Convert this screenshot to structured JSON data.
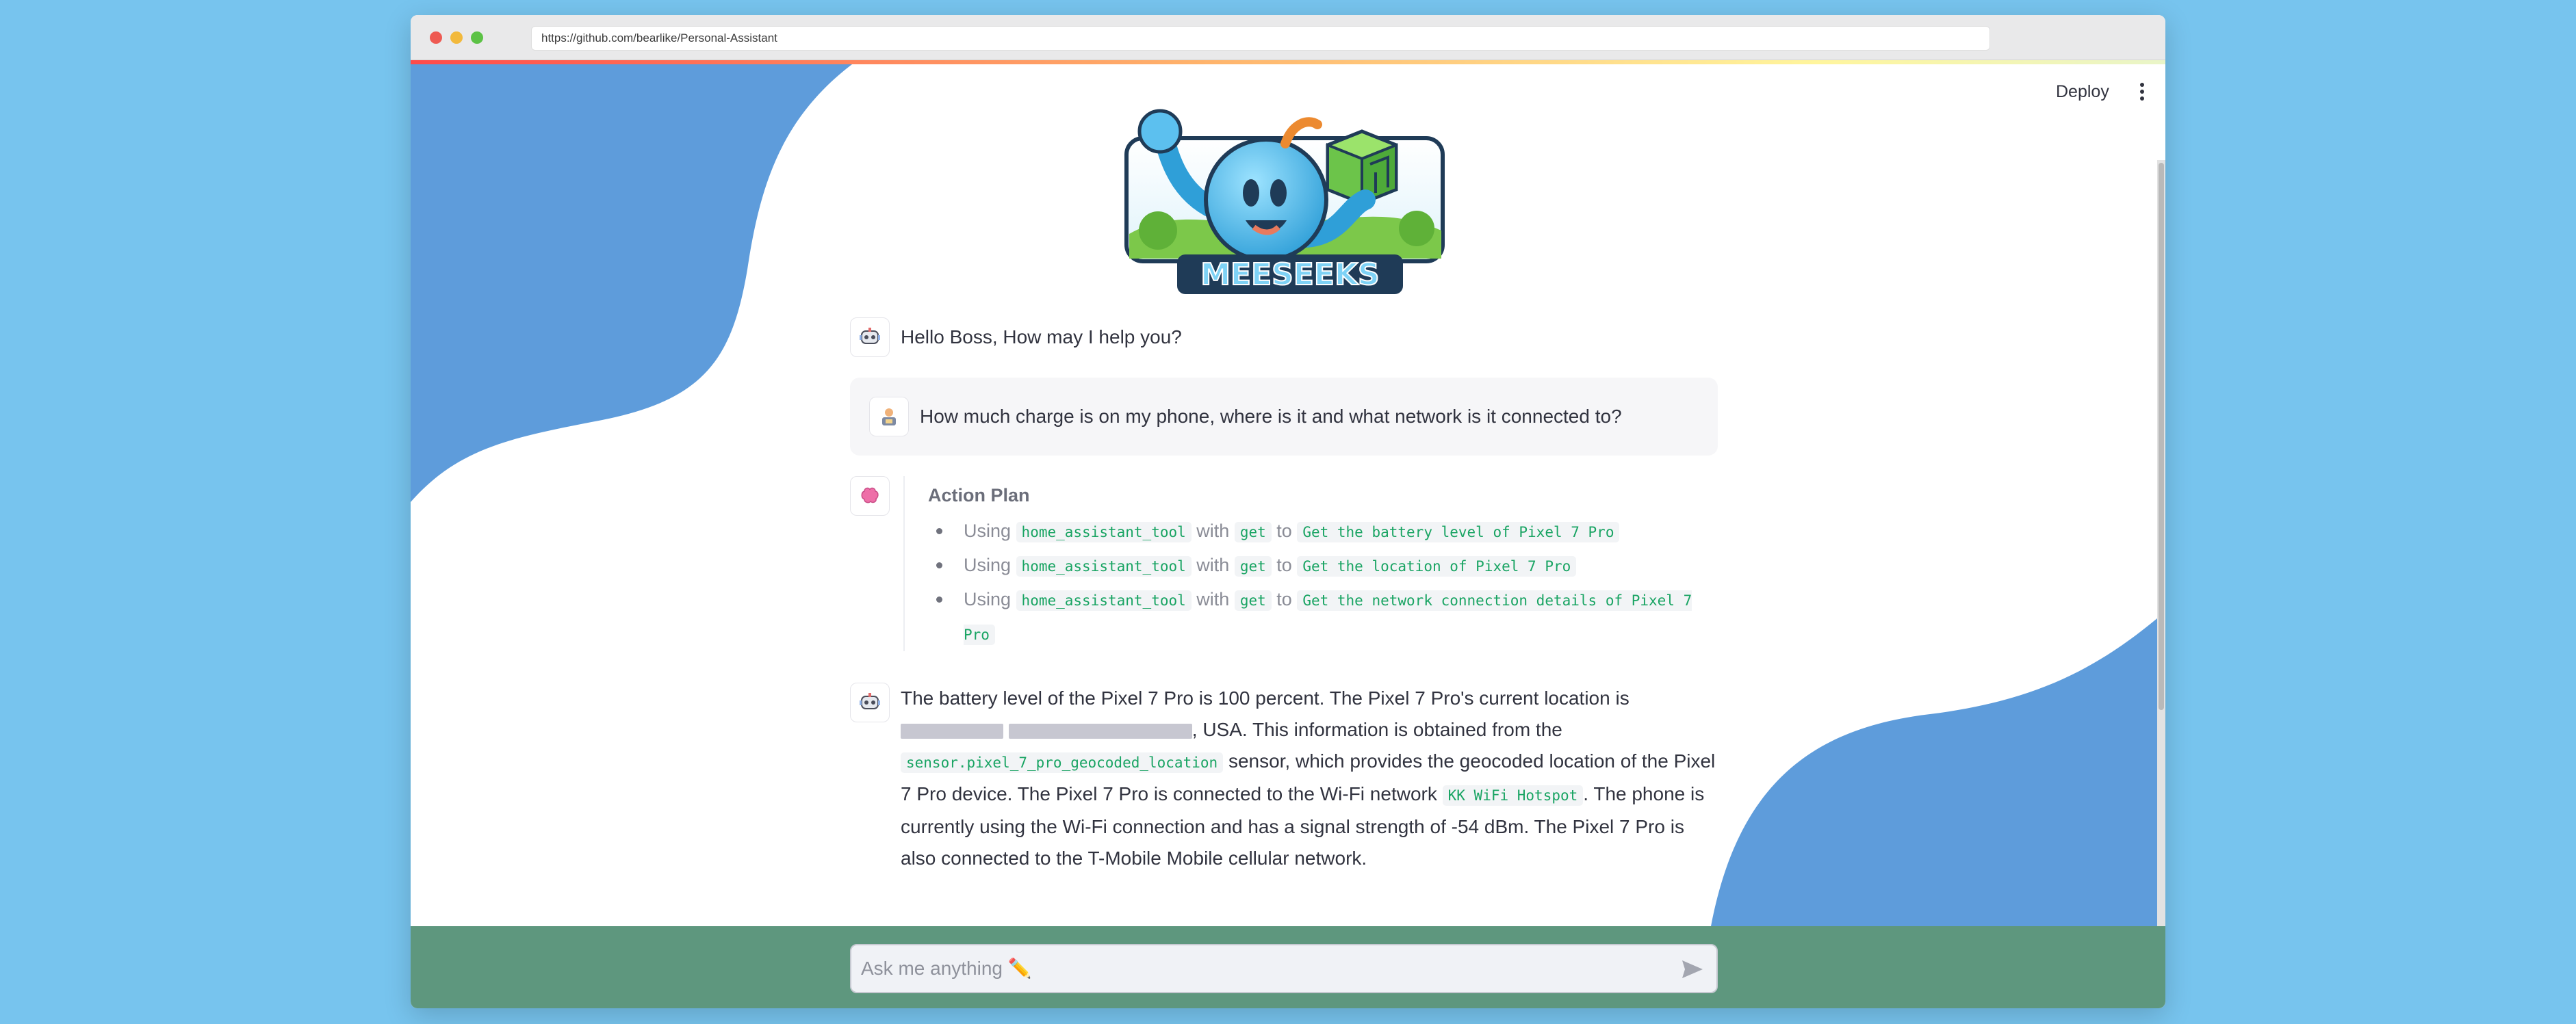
{
  "browser": {
    "url": "https://github.com/bearlike/Personal-Assistant"
  },
  "header": {
    "deploy_label": "Deploy"
  },
  "logo": {
    "text": "MEESEEKS"
  },
  "messages": {
    "greeting": "Hello Boss, How may I help you?",
    "user_question": "How much charge is on my phone, where is it and what network is it connected to?",
    "plan": {
      "title": "Action Plan",
      "using_word": "Using",
      "with_word": "with",
      "to_word": "to",
      "steps": [
        {
          "tool": "home_assistant_tool",
          "method": "get",
          "task": "Get the battery level of Pixel 7 Pro"
        },
        {
          "tool": "home_assistant_tool",
          "method": "get",
          "task": "Get the location of Pixel 7 Pro"
        },
        {
          "tool": "home_assistant_tool",
          "method": "get",
          "task": "Get the network connection details of Pixel 7 Pro"
        }
      ]
    },
    "answer": {
      "part1": "The battery level of the Pixel 7 Pro is 100 percent. The Pixel 7 Pro's current location is",
      "part2": ", USA. This information is obtained from the",
      "sensor": "sensor.pixel_7_pro_geocoded_location",
      "part3": "sensor, which provides the geocoded location of the Pixel 7 Pro device. The Pixel 7 Pro is connected to the Wi-Fi network",
      "network": "KK WiFi Hotspot",
      "part4": ". The phone is currently using the Wi-Fi connection and has a signal strength of -54 dBm. The Pixel 7 Pro is also connected to the T-Mobile Mobile cellular network."
    }
  },
  "input": {
    "placeholder": "Ask me anything ✏️"
  },
  "colors": {
    "page_background": "#77c4ee",
    "blob_blue": "#5e9cdb",
    "footer_green": "#5e977e",
    "code_green": "#19a463"
  }
}
